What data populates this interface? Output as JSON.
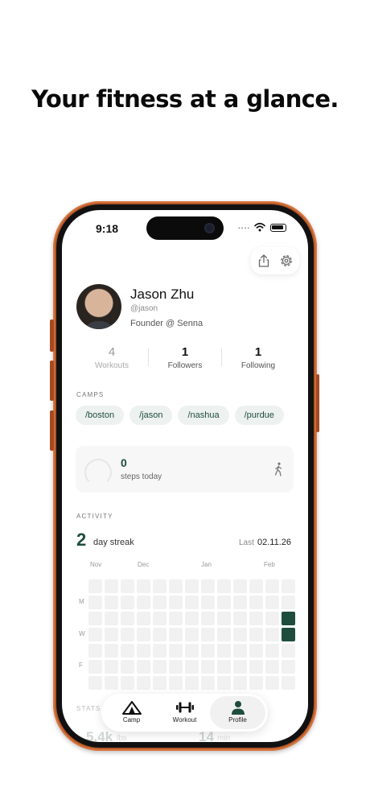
{
  "headline": "Your fitness at a glance.",
  "status_bar": {
    "time": "9:18"
  },
  "profile": {
    "name": "Jason Zhu",
    "handle": "@jason",
    "bio": "Founder @ Senna",
    "stats": [
      {
        "value": "4",
        "label": "Workouts"
      },
      {
        "value": "1",
        "label": "Followers"
      },
      {
        "value": "1",
        "label": "Following"
      }
    ]
  },
  "camps": {
    "label": "CAMPS",
    "items": [
      "/boston",
      "/jason",
      "/nashua",
      "/purdue"
    ]
  },
  "steps": {
    "value": "0",
    "label": "steps today"
  },
  "activity": {
    "label": "ACTIVITY",
    "streak_value": "2",
    "streak_label": "day streak",
    "last_label": "Last",
    "last_date": "02.11.26",
    "months": [
      "Nov",
      "Dec",
      "Jan",
      "Feb"
    ],
    "weekdays": [
      "M",
      "W",
      "F"
    ],
    "weeks": 13,
    "days": 7,
    "active_cells": [
      [
        12,
        2
      ],
      [
        12,
        3
      ]
    ]
  },
  "stats_preview": {
    "label": "STATS",
    "a_value": "5.4k",
    "a_unit": "lbs",
    "b_value": "14",
    "b_unit": "min"
  },
  "tabbar": {
    "tabs": [
      {
        "label": "Camp"
      },
      {
        "label": "Workout"
      },
      {
        "label": "Profile"
      }
    ],
    "active_index": 2
  },
  "colors": {
    "accent": "#1f4d3d",
    "frame": "#b4572a",
    "chip_bg": "#edf1ef"
  }
}
